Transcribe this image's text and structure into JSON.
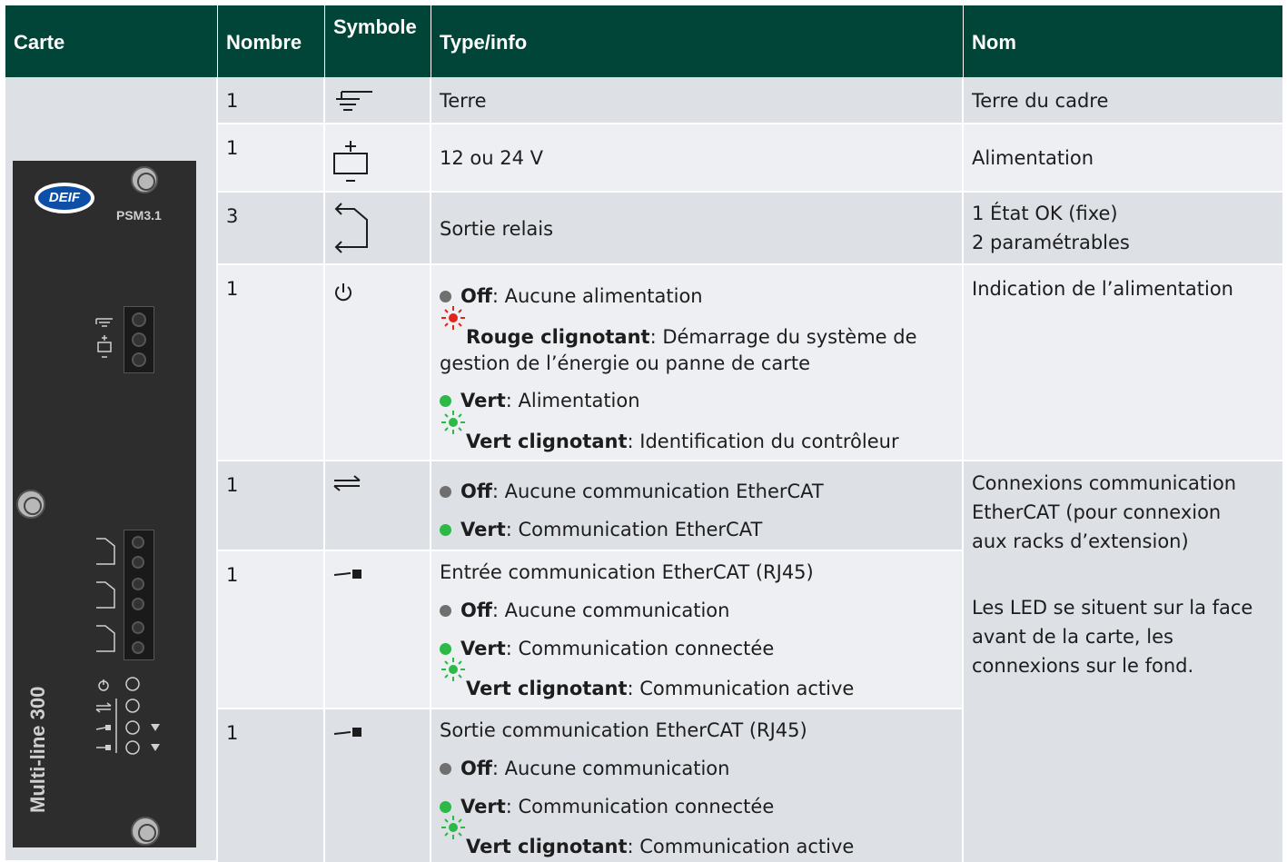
{
  "headers": {
    "carte": "Carte",
    "nombre": "Nombre",
    "symbole": "Symbole",
    "type": "Type/info",
    "nom": "Nom"
  },
  "card": {
    "brand": "DEIF",
    "model": "PSM3.1",
    "series": "Multi-line 300"
  },
  "rows": [
    {
      "count": "1",
      "symbol": "frame-ground-icon",
      "type": "Terre",
      "name": "Terre du cadre"
    },
    {
      "count": "1",
      "symbol": "power-supply-icon",
      "type": "12 ou 24 V",
      "name": "Alimentation"
    },
    {
      "count": "3",
      "symbol": "relay-output-icon",
      "type": "Sortie relais",
      "name_line1": "1 État OK (fixe)",
      "name_line2": "2 paramétrables"
    },
    {
      "count": "1",
      "symbol": "power-icon",
      "name": "Indication de l’alimentation",
      "leds": [
        {
          "state": "grey",
          "label": "Off",
          "text": " : Aucune alimentation"
        },
        {
          "state": "red-blink",
          "label": "Rouge clignotant",
          "text": " : Démarrage du système de",
          "text_cont": "gestion de l’énergie ou panne de carte"
        },
        {
          "state": "green",
          "label": "Vert",
          "text": " : Alimentation"
        },
        {
          "state": "green-blink",
          "label": "Vert clignotant",
          "text": " : Identification du contrôleur"
        }
      ]
    },
    {
      "count": "1",
      "symbol": "ethercat-icon",
      "leds": [
        {
          "state": "grey",
          "label": "Off",
          "text": " : Aucune communication EtherCAT"
        },
        {
          "state": "green",
          "label": "Vert",
          "text": " : Communication EtherCAT"
        }
      ]
    },
    {
      "count": "1",
      "symbol": "ethercat-in-icon",
      "title": "Entrée communication EtherCAT (RJ45)",
      "leds": [
        {
          "state": "grey",
          "label": "Off",
          "text": " : Aucune communication"
        },
        {
          "state": "green",
          "label": "Vert",
          "text": " : Communication connectée"
        },
        {
          "state": "green-blink",
          "label": "Vert clignotant",
          "text": " : Communication active"
        }
      ]
    },
    {
      "count": "1",
      "symbol": "ethercat-out-icon",
      "title": "Sortie communication EtherCAT (RJ45)",
      "leds": [
        {
          "state": "grey",
          "label": "Off",
          "text": " : Aucune communication"
        },
        {
          "state": "green",
          "label": "Vert",
          "text": " : Communication connectée"
        },
        {
          "state": "green-blink",
          "label": "Vert clignotant",
          "text": " : Communication active"
        }
      ]
    }
  ],
  "ethercat_name": {
    "line1": "Connexions communication",
    "line2": "EtherCAT (pour connexion",
    "line3": "aux racks d’extension)",
    "note1": "Les LED se situent sur la face",
    "note2": "avant de la carte, les",
    "note3": "connexions sur le fond."
  },
  "colors": {
    "header_bg": "#004537",
    "row_a": "#dde0e5",
    "row_b": "#edeff2",
    "led_green": "#2cb946",
    "led_red": "#e0261b",
    "led_grey": "#6f6f6f"
  }
}
